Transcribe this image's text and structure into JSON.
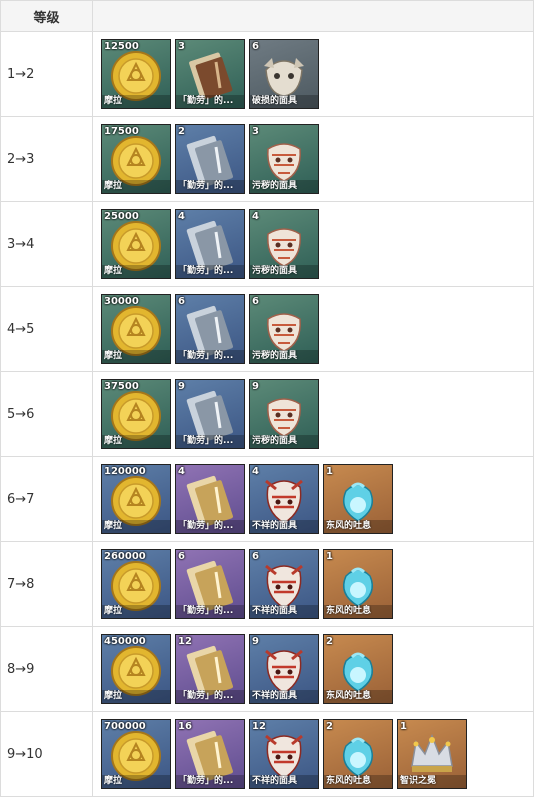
{
  "header": {
    "level": "等级"
  },
  "icons": {
    "mora": "coin-icon",
    "book_teaching": "tome-icon",
    "book_guide": "tome-icon",
    "book_philosophy": "tome-icon",
    "mask_slime": "mask-icon",
    "mask_stained": "mask-icon",
    "mask_ominous": "mask-icon",
    "breath": "pouch-icon",
    "crown": "crown-icon"
  },
  "rows": [
    {
      "level": "1→2",
      "items": [
        {
          "count": "12500",
          "name": "摩拉",
          "kind": "mora",
          "q": "q2"
        },
        {
          "count": "3",
          "name": "「勤劳」的...",
          "kind": "book_teaching",
          "q": "q2"
        },
        {
          "count": "6",
          "name": "破损的面具",
          "kind": "mask_slime",
          "q": "q1"
        }
      ]
    },
    {
      "level": "2→3",
      "items": [
        {
          "count": "17500",
          "name": "摩拉",
          "kind": "mora",
          "q": "q2"
        },
        {
          "count": "2",
          "name": "「勤劳」的...",
          "kind": "book_guide",
          "q": "q3"
        },
        {
          "count": "3",
          "name": "污秽的面具",
          "kind": "mask_stained",
          "q": "q2"
        }
      ]
    },
    {
      "level": "3→4",
      "items": [
        {
          "count": "25000",
          "name": "摩拉",
          "kind": "mora",
          "q": "q2"
        },
        {
          "count": "4",
          "name": "「勤劳」的...",
          "kind": "book_guide",
          "q": "q3"
        },
        {
          "count": "4",
          "name": "污秽的面具",
          "kind": "mask_stained",
          "q": "q2"
        }
      ]
    },
    {
      "level": "4→5",
      "items": [
        {
          "count": "30000",
          "name": "摩拉",
          "kind": "mora",
          "q": "q2"
        },
        {
          "count": "6",
          "name": "「勤劳」的...",
          "kind": "book_guide",
          "q": "q3"
        },
        {
          "count": "6",
          "name": "污秽的面具",
          "kind": "mask_stained",
          "q": "q2"
        }
      ]
    },
    {
      "level": "5→6",
      "items": [
        {
          "count": "37500",
          "name": "摩拉",
          "kind": "mora",
          "q": "q2"
        },
        {
          "count": "9",
          "name": "「勤劳」的...",
          "kind": "book_guide",
          "q": "q3"
        },
        {
          "count": "9",
          "name": "污秽的面具",
          "kind": "mask_stained",
          "q": "q2"
        }
      ]
    },
    {
      "level": "6→7",
      "items": [
        {
          "count": "120000",
          "name": "摩拉",
          "kind": "mora",
          "q": "q3"
        },
        {
          "count": "4",
          "name": "「勤劳」的...",
          "kind": "book_philosophy",
          "q": "q4"
        },
        {
          "count": "4",
          "name": "不祥的面具",
          "kind": "mask_ominous",
          "q": "q3"
        },
        {
          "count": "1",
          "name": "东风的吐息",
          "kind": "breath",
          "q": "q5"
        }
      ]
    },
    {
      "level": "7→8",
      "items": [
        {
          "count": "260000",
          "name": "摩拉",
          "kind": "mora",
          "q": "q3"
        },
        {
          "count": "6",
          "name": "「勤劳」的...",
          "kind": "book_philosophy",
          "q": "q4"
        },
        {
          "count": "6",
          "name": "不祥的面具",
          "kind": "mask_ominous",
          "q": "q3"
        },
        {
          "count": "1",
          "name": "东风的吐息",
          "kind": "breath",
          "q": "q5"
        }
      ]
    },
    {
      "level": "8→9",
      "items": [
        {
          "count": "450000",
          "name": "摩拉",
          "kind": "mora",
          "q": "q3"
        },
        {
          "count": "12",
          "name": "「勤劳」的...",
          "kind": "book_philosophy",
          "q": "q4"
        },
        {
          "count": "9",
          "name": "不祥的面具",
          "kind": "mask_ominous",
          "q": "q3"
        },
        {
          "count": "2",
          "name": "东风的吐息",
          "kind": "breath",
          "q": "q5"
        }
      ]
    },
    {
      "level": "9→10",
      "items": [
        {
          "count": "700000",
          "name": "摩拉",
          "kind": "mora",
          "q": "q3"
        },
        {
          "count": "16",
          "name": "「勤劳」的...",
          "kind": "book_philosophy",
          "q": "q4"
        },
        {
          "count": "12",
          "name": "不祥的面具",
          "kind": "mask_ominous",
          "q": "q3"
        },
        {
          "count": "2",
          "name": "东风的吐息",
          "kind": "breath",
          "q": "q5"
        },
        {
          "count": "1",
          "name": "智识之冕",
          "kind": "crown",
          "q": "q5"
        }
      ]
    }
  ]
}
